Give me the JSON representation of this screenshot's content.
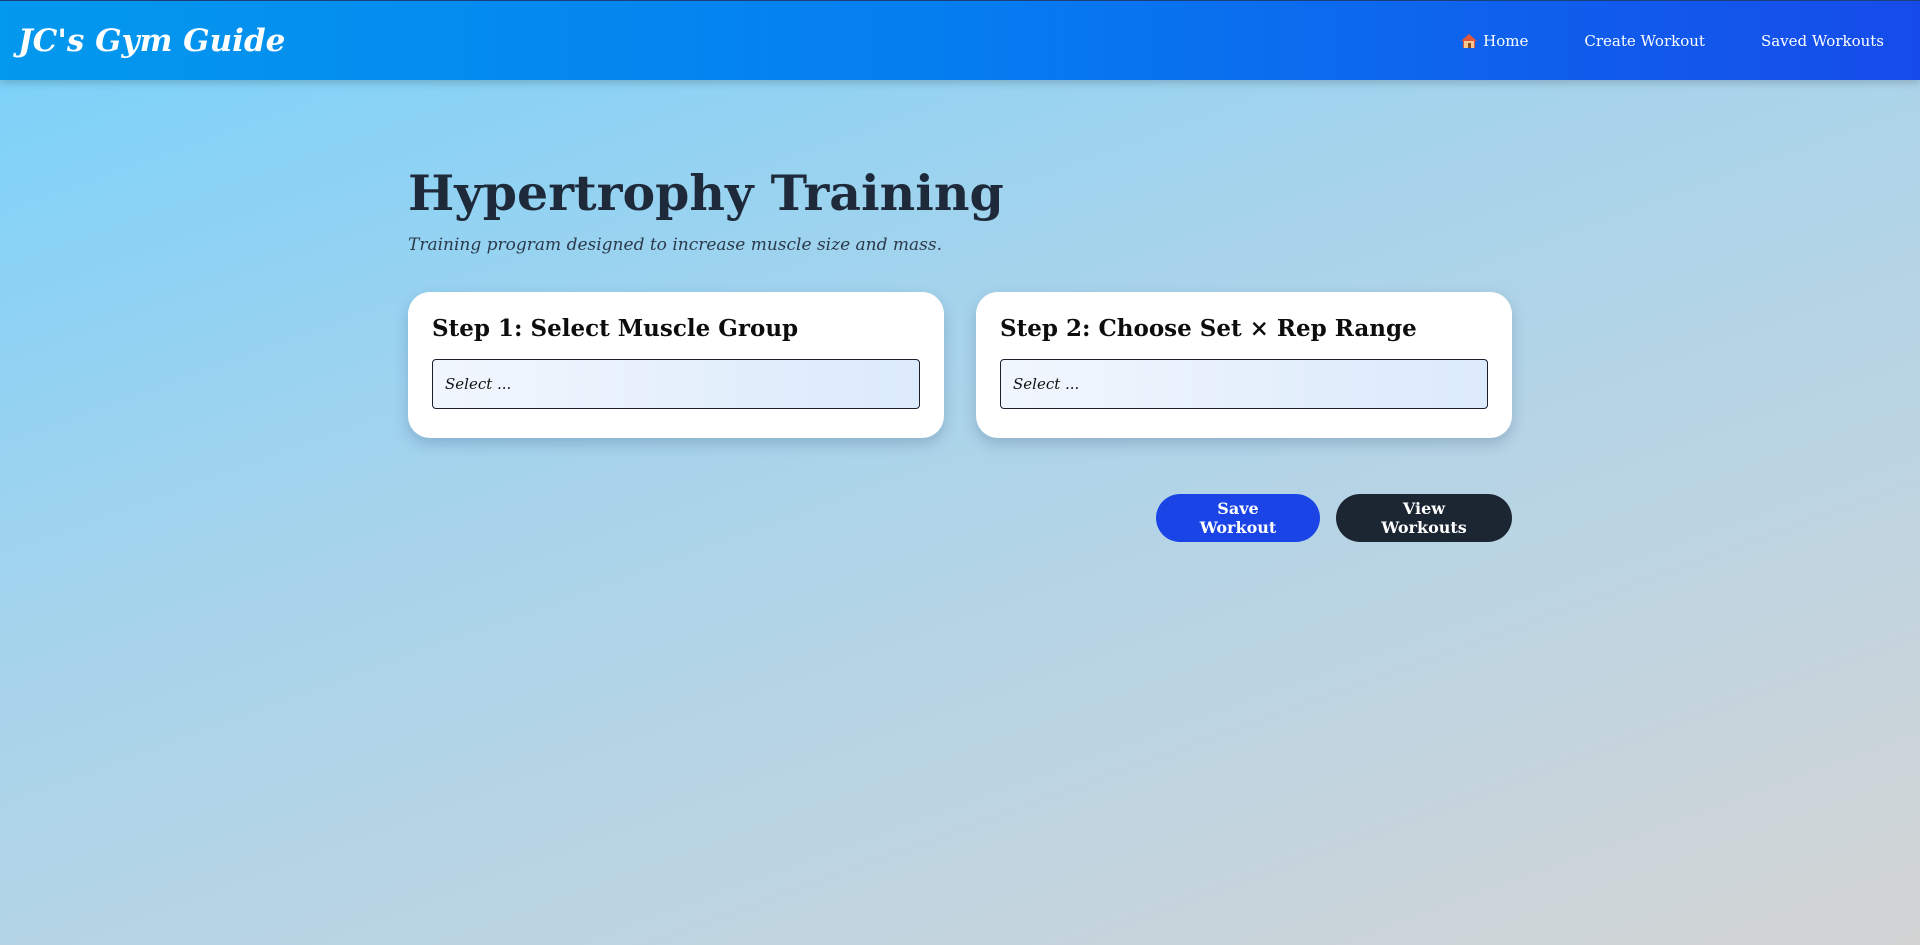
{
  "navbar": {
    "brand": "JC's Gym Guide",
    "links": [
      {
        "label": "Home",
        "icon": "home-icon"
      },
      {
        "label": "Create Workout"
      },
      {
        "label": "Saved Workouts"
      }
    ]
  },
  "main": {
    "title": "Hypertrophy Training",
    "subtitle": "Training program designed to increase muscle size and mass.",
    "steps": [
      {
        "title": "Step 1: Select Muscle Group",
        "select_value": "Select ..."
      },
      {
        "title": "Step 2: Choose Set × Rep Range",
        "select_value": "Select ..."
      }
    ],
    "buttons": {
      "save": "Save Workout",
      "view": "View Workouts"
    }
  },
  "colors": {
    "nav_start": "#0399ee",
    "nav_end": "#164bea",
    "save_button": "#1a44e6",
    "view_button": "#1c2633",
    "title_text": "#1e2a3a"
  }
}
